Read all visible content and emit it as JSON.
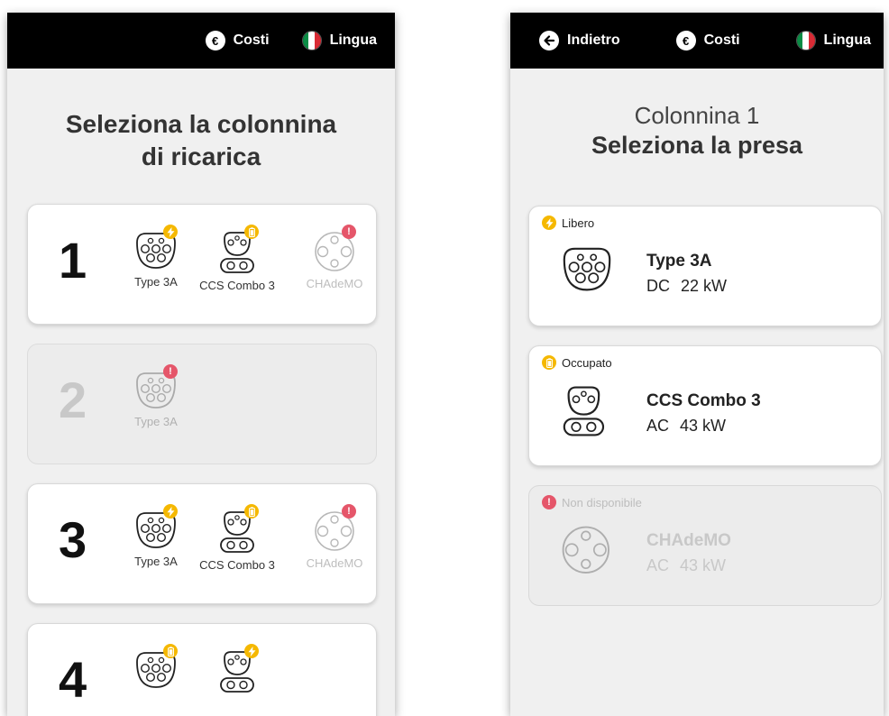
{
  "colors": {
    "available": "#f5b800",
    "occupied": "#f5b800",
    "unavailable": "#e5566a",
    "topbar": "#000000"
  },
  "left": {
    "topbar": {
      "costs_label": "Costi",
      "costs_icon": "euro-icon",
      "language_label": "Lingua",
      "language_icon": "italy-flag-icon"
    },
    "title_line1": "Seleziona la colonnina",
    "title_line2": "di ricarica",
    "columns": [
      {
        "number": "1",
        "enabled": true,
        "connectors": [
          {
            "name": "Type 3A",
            "type": "type3a",
            "status": "available",
            "status_icon": "bolt-icon"
          },
          {
            "name": "CCS Combo 3",
            "type": "ccs",
            "status": "occupied",
            "status_icon": "battery-icon"
          },
          {
            "name": "CHAdeMO",
            "type": "chademo",
            "status": "unavailable",
            "status_icon": "exclamation-icon"
          }
        ]
      },
      {
        "number": "2",
        "enabled": false,
        "connectors": [
          {
            "name": "Type 3A",
            "type": "type3a",
            "status": "unavailable",
            "status_icon": "exclamation-icon"
          }
        ]
      },
      {
        "number": "3",
        "enabled": true,
        "connectors": [
          {
            "name": "Type 3A",
            "type": "type3a",
            "status": "available",
            "status_icon": "bolt-icon"
          },
          {
            "name": "CCS Combo 3",
            "type": "ccs",
            "status": "occupied",
            "status_icon": "battery-icon"
          },
          {
            "name": "CHAdeMO",
            "type": "chademo",
            "status": "unavailable",
            "status_icon": "exclamation-icon"
          }
        ]
      },
      {
        "number": "4",
        "enabled": true,
        "connectors": [
          {
            "name": "",
            "type": "type3a",
            "status": "occupied",
            "status_icon": "battery-icon"
          },
          {
            "name": "",
            "type": "ccs",
            "status": "available",
            "status_icon": "bolt-icon"
          }
        ]
      }
    ]
  },
  "right": {
    "topbar": {
      "back_label": "Indietro",
      "back_icon": "arrow-left-icon",
      "costs_label": "Costi",
      "costs_icon": "euro-icon",
      "language_label": "Lingua",
      "language_icon": "italy-flag-icon"
    },
    "title_line1": "Colonnina 1",
    "title_line2": "Seleziona la presa",
    "sockets": [
      {
        "status_label": "Libero",
        "status": "available",
        "status_icon": "bolt-icon",
        "name": "Type 3A",
        "current": "DC",
        "power": "22 kW",
        "type": "type3a",
        "enabled": true
      },
      {
        "status_label": "Occupato",
        "status": "occupied",
        "status_icon": "battery-icon",
        "name": "CCS Combo 3",
        "current": "AC",
        "power": "43 kW",
        "type": "ccs",
        "enabled": true
      },
      {
        "status_label": "Non disponibile",
        "status": "unavailable",
        "status_icon": "exclamation-icon",
        "name": "CHAdeMO",
        "current": "AC",
        "power": "43 kW",
        "type": "chademo",
        "enabled": false
      }
    ]
  }
}
